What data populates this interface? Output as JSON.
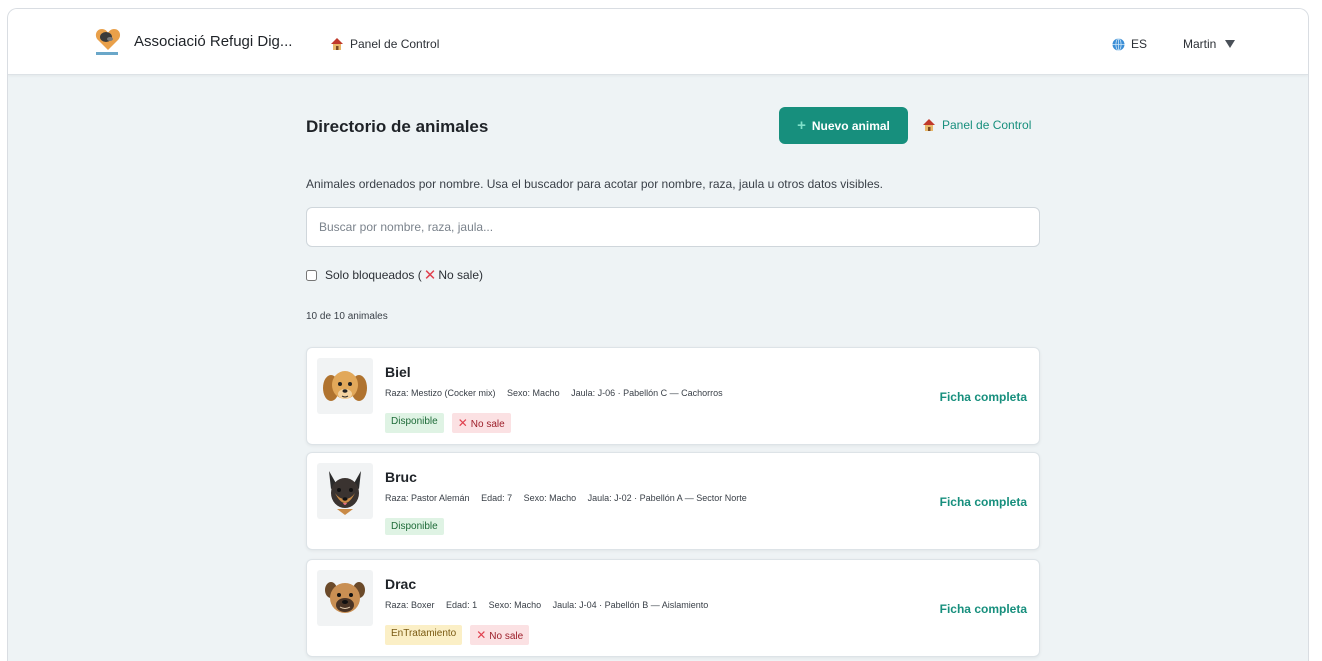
{
  "app": {
    "name": "Associació Refugi Dig..."
  },
  "topbar": {
    "panel_link": "Panel de Control",
    "language": "ES",
    "user": "Martin"
  },
  "page": {
    "title": "Directorio de animales",
    "new_button": "Nuevo animal",
    "side_link": "Panel de Control",
    "subtitle": "Animales ordenados por nombre. Usa el buscador para acotar por nombre, raza, jaula u otros datos visibles.",
    "search_placeholder": "Buscar por nombre, raza, jaula...",
    "filter_label_prefix": "Solo bloqueados (",
    "filter_label_suffix": " No sale)",
    "count": "10 de 10 animales"
  },
  "animals": [
    {
      "name": "Biel",
      "raza": "Raza: Mestizo (Cocker mix)",
      "edad": "",
      "sexo": "Sexo: Macho",
      "jaula": "Jaula: J-06 · Pabellón C — Cachorros",
      "status": "Disponible",
      "no_sale": "No sale",
      "link": "Ficha completa",
      "icon": "cocker-dog-icon"
    },
    {
      "name": "Bruc",
      "raza": "Raza: Pastor Alemán",
      "edad": "Edad: 7",
      "sexo": "Sexo: Macho",
      "jaula": "Jaula: J-02 · Pabellón A — Sector Norte",
      "status": "Disponible",
      "no_sale": "",
      "link": "Ficha completa",
      "icon": "german-shepherd-icon"
    },
    {
      "name": "Drac",
      "raza": "Raza: Boxer",
      "edad": "Edad: 1",
      "sexo": "Sexo: Macho",
      "jaula": "Jaula: J-04 · Pabellón B — Aislamiento",
      "status": "EnTratamiento",
      "no_sale": "No sale",
      "link": "Ficha completa",
      "icon": "boxer-dog-icon"
    }
  ],
  "colors": {
    "accent": "#178f7d",
    "status_available_bg": "#dff3e4",
    "status_treatment_bg": "#fbefc6",
    "no_sale_bg": "#fbe1e3",
    "no_sale_mark": "#e0414f"
  }
}
